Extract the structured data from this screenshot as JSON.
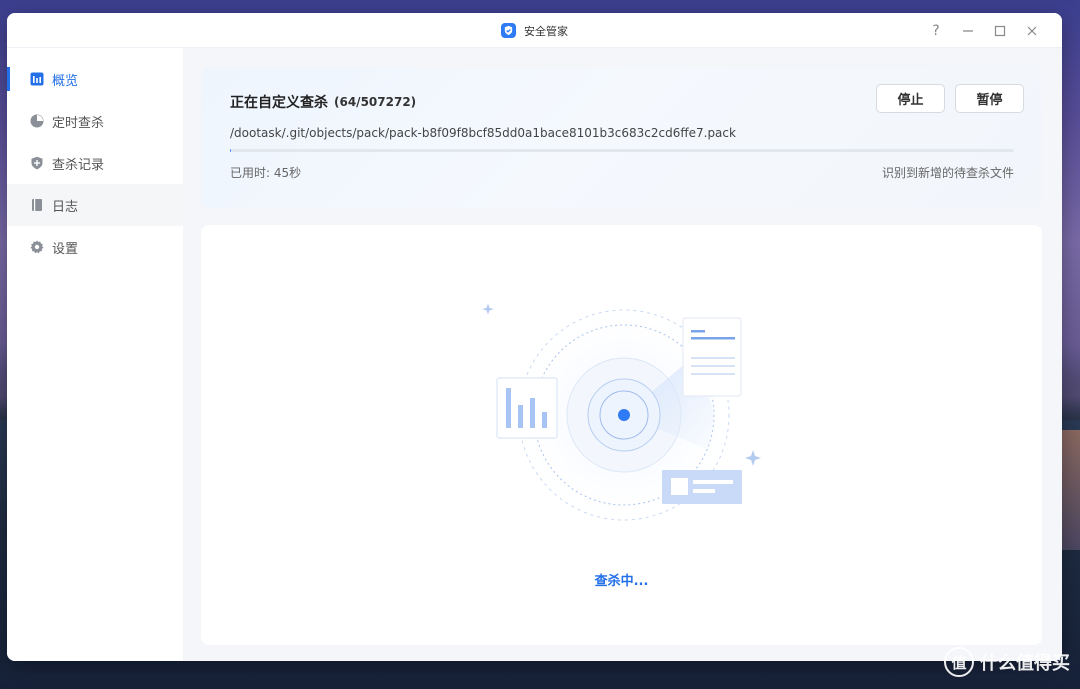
{
  "window": {
    "title": "安全管家",
    "controls": [
      "?",
      "—",
      "☐",
      "✕"
    ]
  },
  "sidebar": {
    "items": [
      {
        "label": "概览",
        "icon": "bar-chart-icon",
        "active": true
      },
      {
        "label": "定时查杀",
        "icon": "clock-pie-icon",
        "active": false
      },
      {
        "label": "查杀记录",
        "icon": "shield-plus-icon",
        "active": false
      },
      {
        "label": "日志",
        "icon": "book-icon",
        "active": false
      },
      {
        "label": "设置",
        "icon": "gear-icon",
        "active": false
      }
    ]
  },
  "scan": {
    "title": "正在自定义查杀",
    "count": "(64/507272)",
    "stop_label": "停止",
    "pause_label": "暂停",
    "current_path": "/dootask/.git/objects/pack/pack-b8f09f8bcf85dd0a1bace8101b3c683c2cd6ffe7.pack",
    "elapsed": "已用时: 45秒",
    "notice": "识别到新增的待查杀文件",
    "progress": 0.0001
  },
  "status": {
    "text": "查杀中..."
  },
  "watermark": {
    "badge": "值",
    "text": "什么值得买"
  },
  "colors": {
    "accent": "#2470e8",
    "brand": "#2f7bf5"
  }
}
